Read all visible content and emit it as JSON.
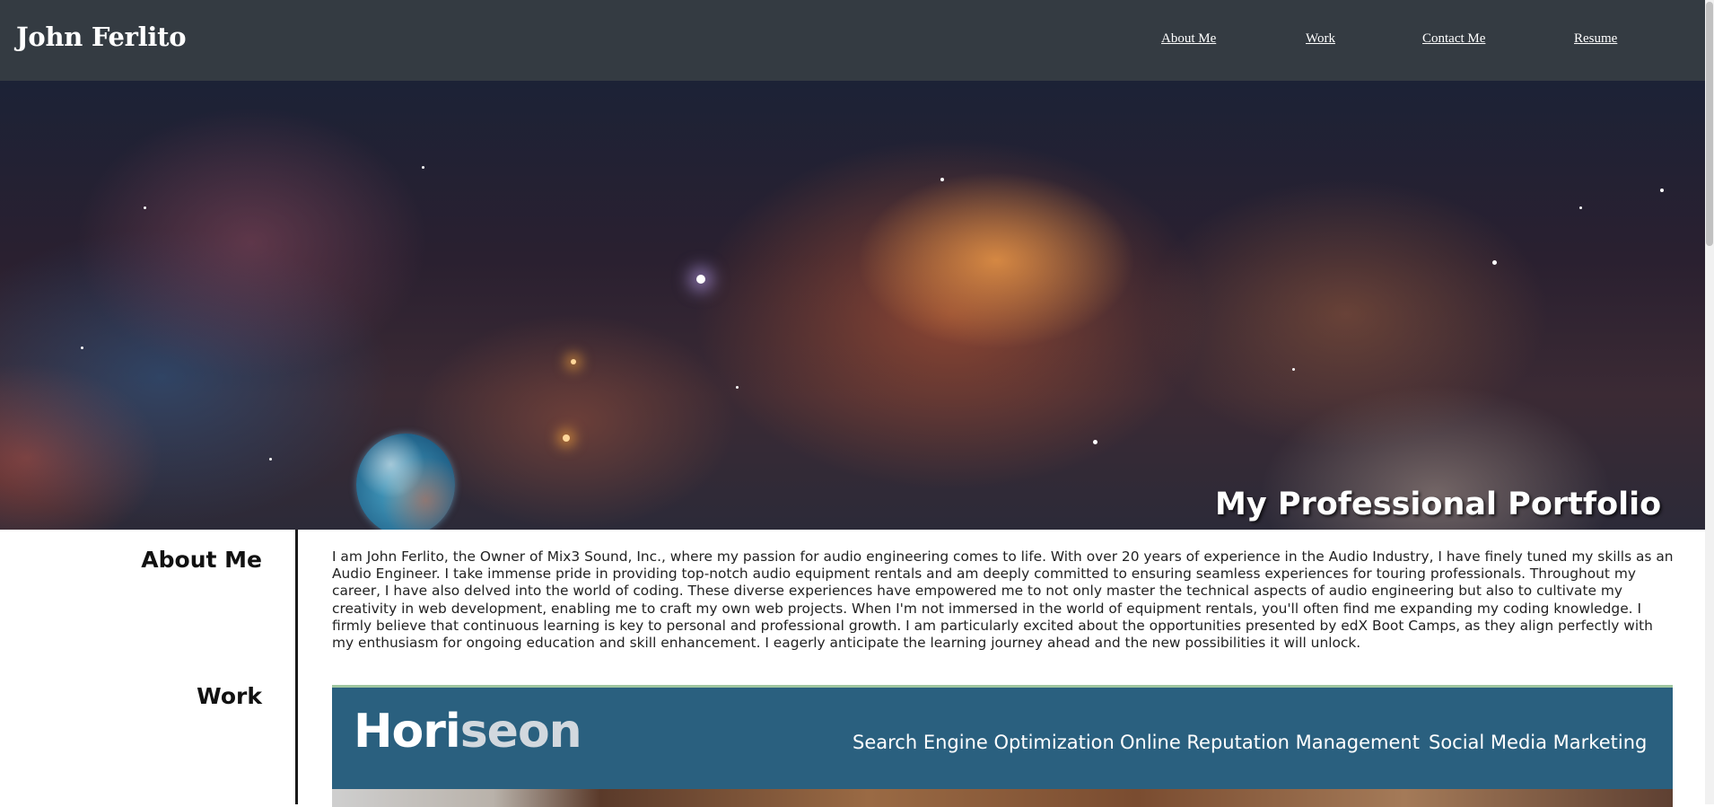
{
  "header": {
    "title": "John Ferlito",
    "nav": [
      {
        "label": "About Me"
      },
      {
        "label": "Work"
      },
      {
        "label": "Contact Me"
      },
      {
        "label": "Resume"
      }
    ]
  },
  "hero": {
    "title": "My Professional Portfolio"
  },
  "about": {
    "heading": "About Me",
    "text": "I am John Ferlito, the Owner of Mix3 Sound, Inc., where my passion for audio engineering comes to life. With over 20 years of experience in the Audio Industry, I have finely tuned my skills as an Audio Engineer. I take immense pride in providing top-notch audio equipment rentals and am deeply committed to ensuring seamless experiences for touring professionals. Throughout my career, I have also delved into the world of coding. These diverse experiences have empowered me to not only master the technical aspects of audio engineering but also to cultivate my creativity in web development, enabling me to craft my own web projects. When I'm not immersed in the world of equipment rentals, you'll often find me expanding my coding knowledge. I firmly believe that continuous learning is key to personal and professional growth. I am particularly excited about the opportunities presented by edX Boot Camps, as they align perfectly with my enthusiasm for ongoing education and skill enhancement. I eagerly anticipate the learning journey ahead and the new possibilities it will unlock."
  },
  "work": {
    "heading": "Work",
    "project": {
      "logo_part1": "Hori",
      "logo_part2": "seon",
      "links": [
        "Search Engine Optimization",
        "Online Reputation Management",
        "Social Media Marketing"
      ]
    }
  },
  "colors": {
    "header_bg": "#343b42",
    "work_banner_bg": "#2a607f",
    "work_banner_border": "#9fc6a0"
  }
}
